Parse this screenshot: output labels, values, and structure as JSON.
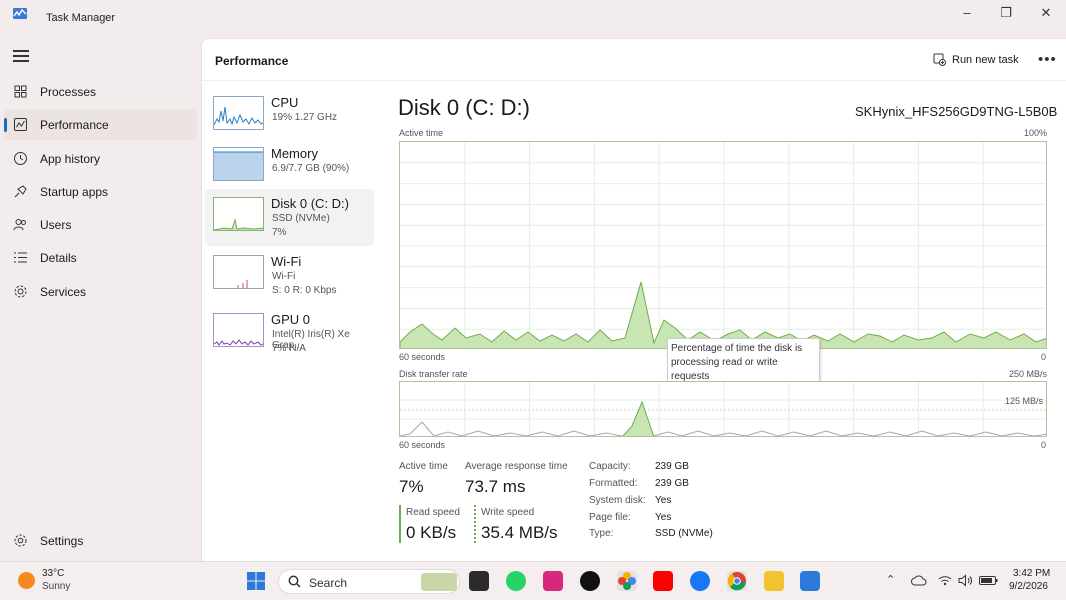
{
  "app": {
    "title": "Task Manager"
  },
  "nav": {
    "items": [
      {
        "label": "Processes",
        "icon": "processes-icon"
      },
      {
        "label": "Performance",
        "icon": "performance-icon",
        "active": true
      },
      {
        "label": "App history",
        "icon": "app-history-icon"
      },
      {
        "label": "Startup apps",
        "icon": "startup-apps-icon"
      },
      {
        "label": "Users",
        "icon": "users-icon"
      },
      {
        "label": "Details",
        "icon": "details-icon"
      },
      {
        "label": "Services",
        "icon": "services-icon"
      }
    ],
    "settings": "Settings"
  },
  "header": {
    "title": "Performance",
    "run_task": "Run new task"
  },
  "devices": [
    {
      "name": "CPU",
      "line1": "19%  1.27 GHz"
    },
    {
      "name": "Memory",
      "line1": "6.9/7.7 GB (90%)"
    },
    {
      "name": "Disk 0 (C: D:)",
      "line1": "SSD (NVMe)",
      "line2": "7%"
    },
    {
      "name": "Wi-Fi",
      "line1": "Wi-Fi",
      "line2": "S: 0  R: 0 Kbps"
    },
    {
      "name": "GPU 0",
      "line1": "Intel(R) Iris(R) Xe Grap...",
      "line2": "7%  N/A"
    }
  ],
  "detail": {
    "title": "Disk 0 (C: D:)",
    "model": "SKHynix_HFS256GD9TNG-L5B0B",
    "active_time_label": "Active time",
    "active_time_max": "100%",
    "active_time_xstart": "60 seconds",
    "active_time_xend": "0",
    "tooltip": "Percentage of time the disk is processing read or write requests",
    "transfer_label": "Disk transfer rate",
    "transfer_max": "250 MB/s",
    "transfer_mid": "125 MB/s",
    "transfer_xstart": "60 seconds",
    "transfer_xend": "0"
  },
  "stats": {
    "active_time_label": "Active time",
    "active_time_value": "7%",
    "response_label": "Average response time",
    "response_value": "73.7 ms",
    "read_label": "Read speed",
    "read_value": "0 KB/s",
    "write_label": "Write speed",
    "write_value": "35.4 MB/s"
  },
  "specs": [
    {
      "label": "Capacity:",
      "value": "239 GB"
    },
    {
      "label": "Formatted:",
      "value": "239 GB"
    },
    {
      "label": "System disk:",
      "value": "Yes"
    },
    {
      "label": "Page file:",
      "value": "Yes"
    },
    {
      "label": "Type:",
      "value": "SSD (NVMe)"
    }
  ],
  "taskbar": {
    "temp": "33°C",
    "weather": "Sunny",
    "search": "Search",
    "time": "3:42 PM",
    "date": "9/2/2026"
  },
  "colors": {
    "disk_fill": "#c9e5b3",
    "disk_line": "#6fae4b",
    "cpu_line": "#2a7fc1",
    "memory_fill": "#bcd3ec",
    "wifi_line": "#c24a7a",
    "gpu_line": "#7a3fb2",
    "accent": "#1c6db9"
  }
}
